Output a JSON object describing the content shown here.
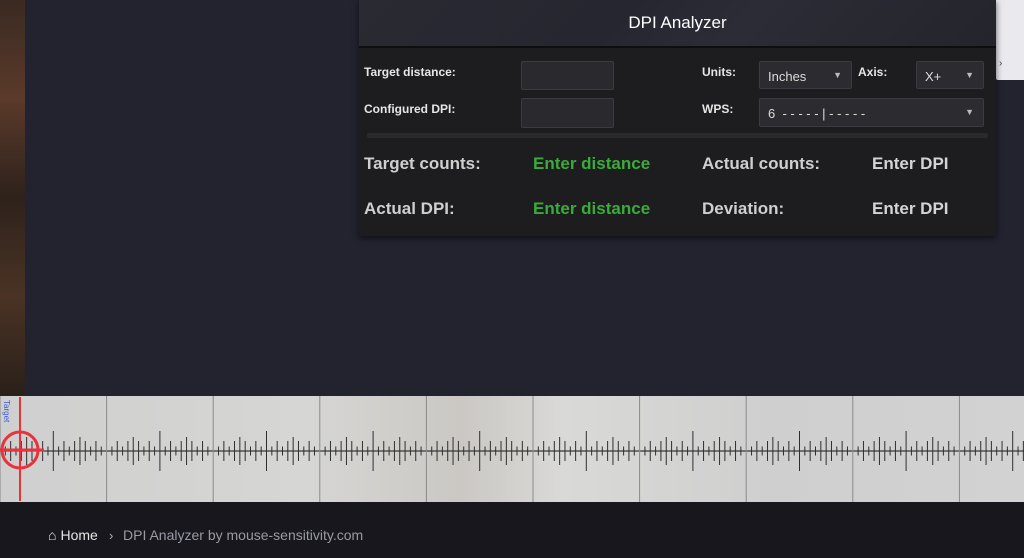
{
  "panel": {
    "title": "DPI Analyzer",
    "target_distance_label": "Target distance:",
    "configured_dpi_label": "Configured DPI:",
    "units_label": "Units:",
    "units_value": "Inches",
    "axis_label": "Axis:",
    "axis_value": "X+",
    "wps_label": "WPS:",
    "wps_value": "6  - - - - - | - - - - -"
  },
  "results": {
    "target_counts_label": "Target counts:",
    "target_counts_value": "Enter distance",
    "actual_counts_label": "Actual counts:",
    "actual_counts_value": "Enter DPI",
    "actual_dpi_label": "Actual DPI:",
    "actual_dpi_value": "Enter distance",
    "deviation_label": "Deviation:",
    "deviation_value": "Enter DPI"
  },
  "ruler": {
    "target_label": "Target"
  },
  "breadcrumb": {
    "home": "Home",
    "separator": "›",
    "current": "DPI Analyzer by mouse-sensitivity.com"
  },
  "colors": {
    "result_green": "#3aab3a",
    "crosshair_red": "#e8323c",
    "target_blue": "#3b5bd8"
  }
}
